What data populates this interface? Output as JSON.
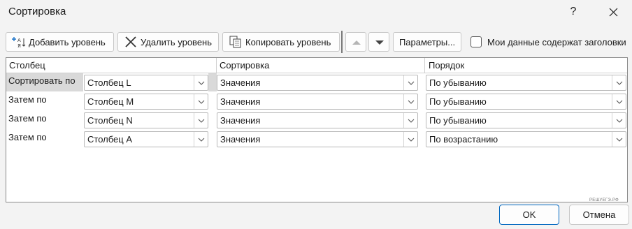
{
  "window": {
    "title": "Сортировка",
    "help_label": "?",
    "accent_color": "#0067c0"
  },
  "toolbar": {
    "add_level": "Добавить уровень",
    "delete_level": "Удалить уровень",
    "copy_level": "Копировать уровень",
    "params": "Параметры...",
    "headers_checkbox_label": "Мои данные содержат заголовки",
    "headers_checked": false
  },
  "grid": {
    "columns": [
      "Столбец",
      "Сортировка",
      "Порядок"
    ],
    "rows": [
      {
        "label": "Сортировать по",
        "column": "Столбец L",
        "sort_on": "Значения",
        "order": "По убыванию"
      },
      {
        "label": "Затем по",
        "column": "Столбец M",
        "sort_on": "Значения",
        "order": "По убыванию"
      },
      {
        "label": "Затем по",
        "column": "Столбец N",
        "sort_on": "Значения",
        "order": "По убыванию"
      },
      {
        "label": "Затем по",
        "column": "Столбец A",
        "sort_on": "Значения",
        "order": "По возрастанию"
      }
    ]
  },
  "watermark": "РЕШУЕГЭ.РФ",
  "footer": {
    "ok": "OK",
    "cancel": "Отмена"
  }
}
